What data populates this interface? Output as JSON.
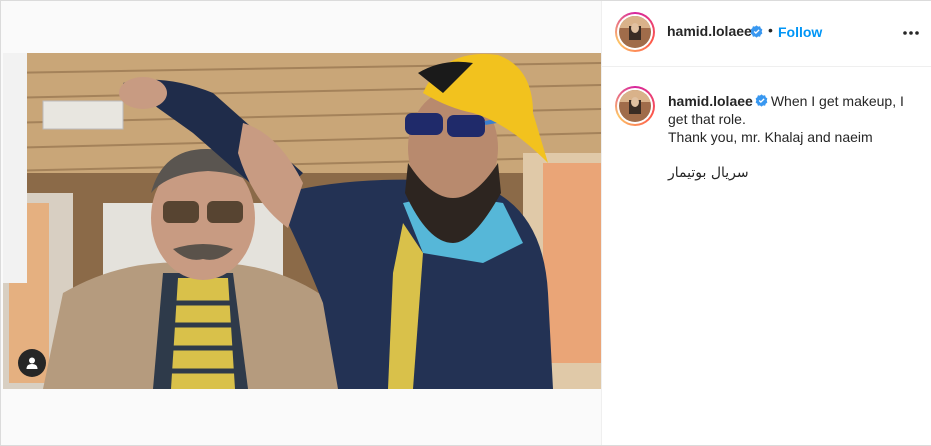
{
  "author": {
    "username": "hamid.lolaee",
    "verified": true,
    "separator": "•",
    "follow_label": "Follow"
  },
  "caption": {
    "username": "hamid.lolaee",
    "line1": "When I get makeup, I get that role.",
    "line2": "Thank you, mr. Khalaj and naeim",
    "line3": "سریال بوتیمار"
  },
  "icons": {
    "more": "more-options-icon",
    "verified": "verified-badge-icon",
    "tag": "user-tag-icon"
  },
  "colors": {
    "accent": "#0095f6",
    "text": "#262626",
    "verified": "#3897f0"
  }
}
